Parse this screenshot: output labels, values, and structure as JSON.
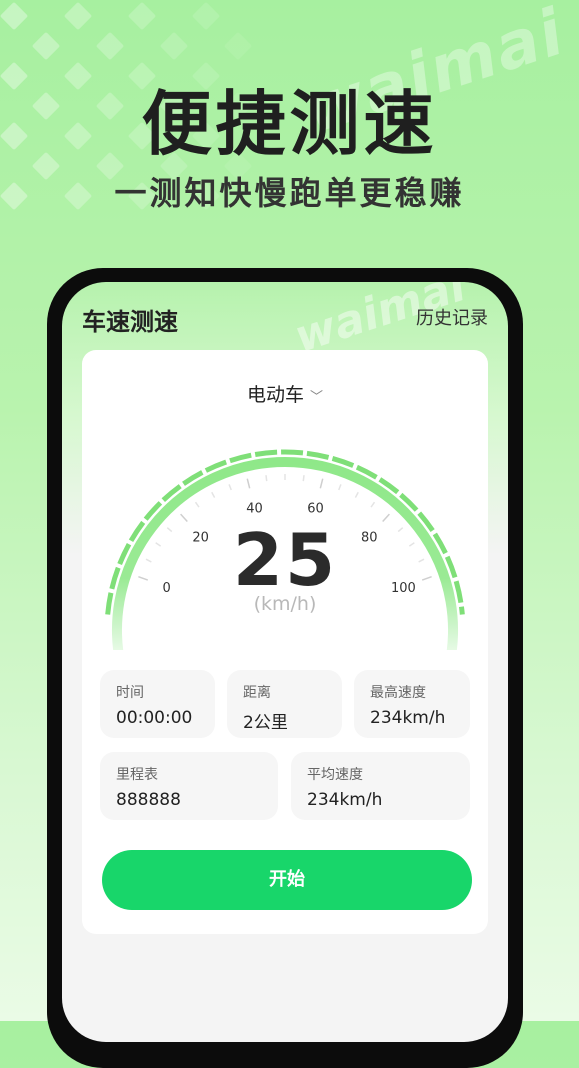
{
  "hero": {
    "title": "便捷测速",
    "subtitle": "一测知快慢跑单更稳赚",
    "watermark": "waimai"
  },
  "app": {
    "title": "车速测速",
    "history_link": "历史记录",
    "vehicle_type": "电动车",
    "speed": "25",
    "unit": "(km/h)",
    "gauge_ticks": [
      "0",
      "20",
      "40",
      "60",
      "80",
      "100"
    ],
    "gauge_value_fraction": 0.25,
    "stats": [
      {
        "label": "时间",
        "value": "00:00:00"
      },
      {
        "label": "距离",
        "value": "2公里"
      },
      {
        "label": "最高速度",
        "value": "234km/h"
      },
      {
        "label": "里程表",
        "value": "888888"
      },
      {
        "label": "平均速度",
        "value": "234km/h"
      }
    ],
    "start_button": "开始"
  },
  "colors": {
    "accent": "#18d66a",
    "gauge_green": "#8fe889",
    "background": "#a7f0a0"
  }
}
